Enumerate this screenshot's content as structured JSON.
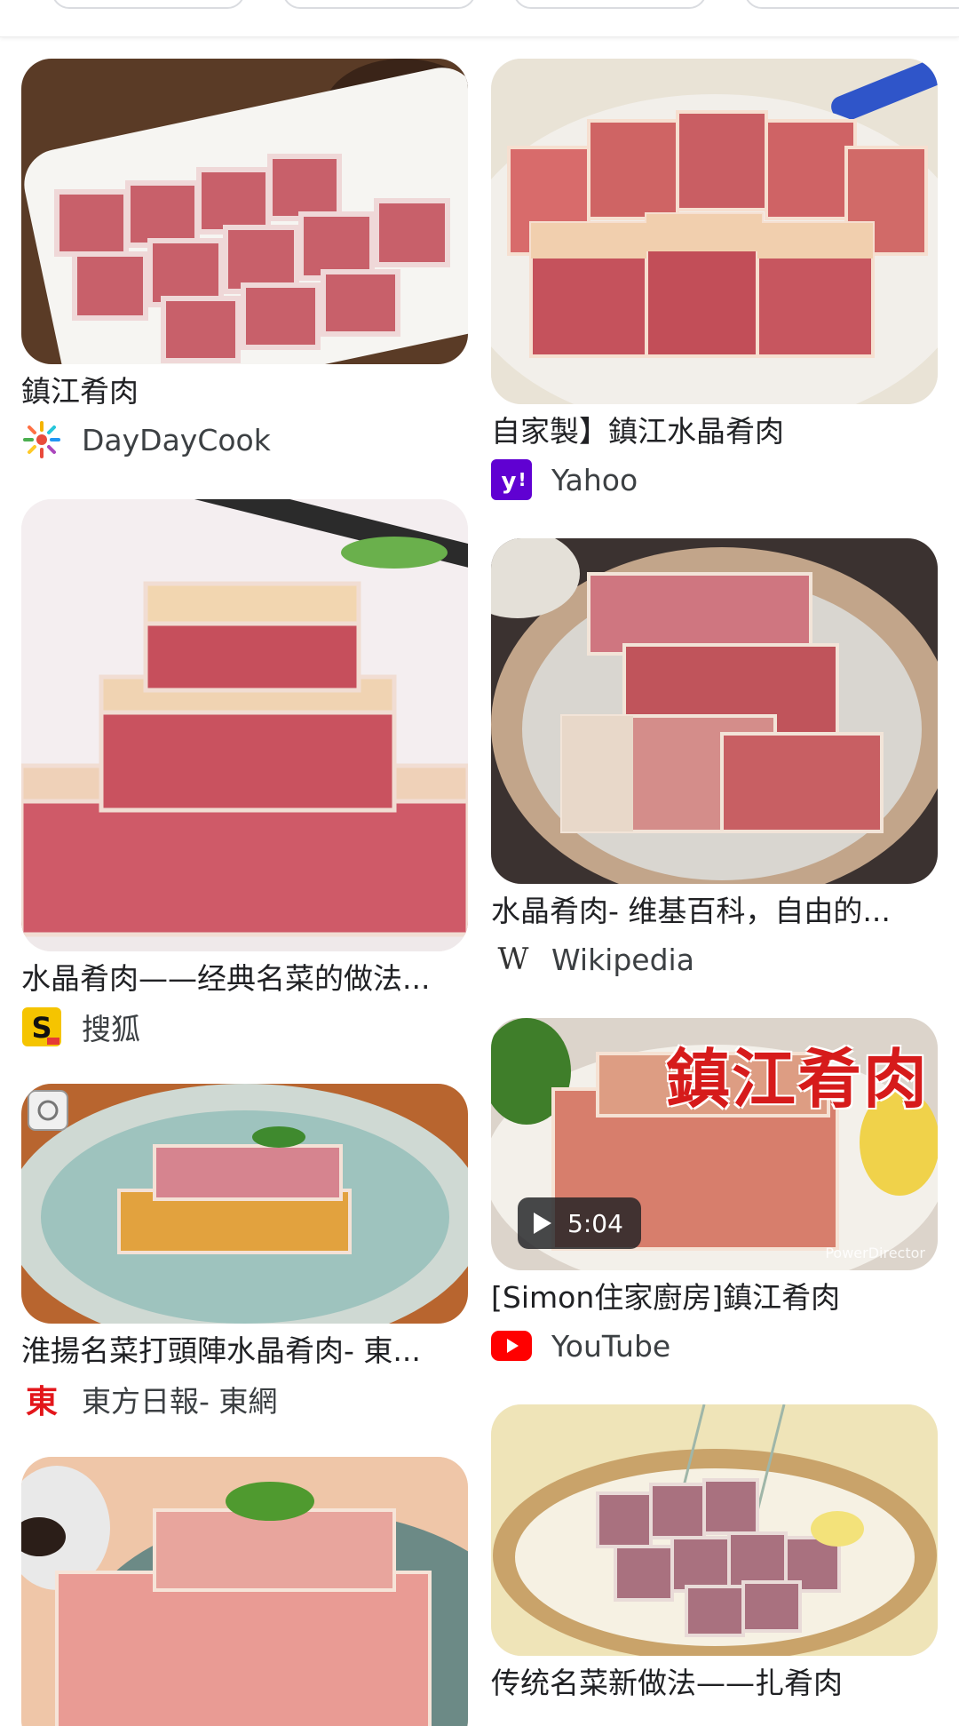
{
  "filter_chips": [
    "",
    "",
    "",
    ""
  ],
  "results": [
    {
      "title": "鎮江肴肉",
      "source": "DayDayCook",
      "icon": "daydaycook-icon"
    },
    {
      "title": "自家製】鎮江水晶肴肉",
      "source": "Yahoo",
      "icon": "yahoo-icon"
    },
    {
      "title": "水晶肴肉——经典名菜的做法...",
      "source": "搜狐",
      "icon": "sohu-icon"
    },
    {
      "title": "水晶肴肉- 维基百科，自由的...",
      "source": "Wikipedia",
      "icon": "wikipedia-icon"
    },
    {
      "title": "淮揚名菜打頭陣水晶肴肉- 東...",
      "source": "東方日報- 東網",
      "icon": "on-cc-icon",
      "icon_text": "東"
    },
    {
      "title": "[Simon住家廚房]鎮江肴肉",
      "source": "YouTube",
      "icon": "youtube-icon",
      "duration": "5:04",
      "overlay_text": "鎮江肴肉",
      "watermark": "PowerDirector"
    },
    {
      "title": "",
      "source": "",
      "icon": ""
    },
    {
      "title": "传统名菜新做法——扎肴肉",
      "source": "",
      "icon": ""
    }
  ],
  "colors": {
    "meat": "#c8545f",
    "jelly": "#ead9c4",
    "plate": "#f5f3ef",
    "yahoo": "#6001d2",
    "youtube": "#ff0000",
    "oncc": "#e3161b",
    "sohu": "#f5c400"
  }
}
